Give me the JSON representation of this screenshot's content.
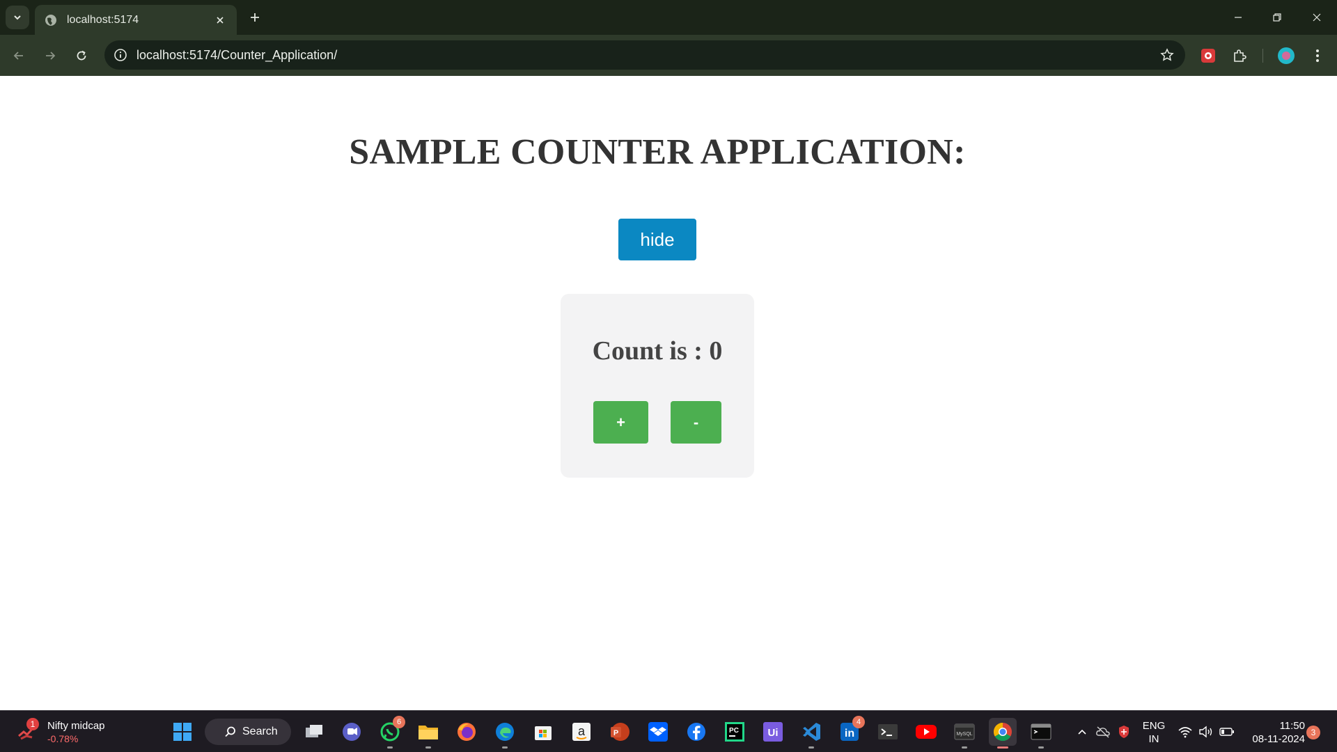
{
  "browser": {
    "tab_title": "localhost:5174",
    "url": "localhost:5174/Counter_Application/"
  },
  "page": {
    "title": "SAMPLE COUNTER APPLICATION:",
    "hide_label": "hide",
    "count_label": "Count is : 0",
    "plus_label": "+",
    "minus_label": "-"
  },
  "colors": {
    "titlebar": "#1b2418",
    "toolbar": "#2e3a2a",
    "hide_button": "#0b88c2",
    "count_button": "#4caf50",
    "card": "#f3f3f4",
    "taskbar": "#1e1b22"
  },
  "taskbar": {
    "widget_title": "Nifty midcap",
    "widget_value": "-0.78%",
    "widget_badge": "1",
    "search_label": "Search",
    "whatsapp_badge": "6",
    "linkedin_badge": "4",
    "lang_top": "ENG",
    "lang_bottom": "IN",
    "time": "11:50",
    "date": "08-11-2024",
    "notification_count": "3",
    "apps": [
      "start-icon",
      "search-icon",
      "task-view-icon",
      "teams-icon",
      "whatsapp-icon",
      "file-explorer-icon",
      "firefox-icon",
      "edge-icon",
      "store-icon",
      "amazon-icon",
      "powerpoint-icon",
      "dropbox-icon",
      "facebook-icon",
      "pycharm-icon",
      "uipath-icon",
      "vscode-icon",
      "linkedin-icon",
      "terminal-icon",
      "youtube-icon",
      "mysql-icon",
      "chrome-icon",
      "cmd-icon"
    ]
  }
}
